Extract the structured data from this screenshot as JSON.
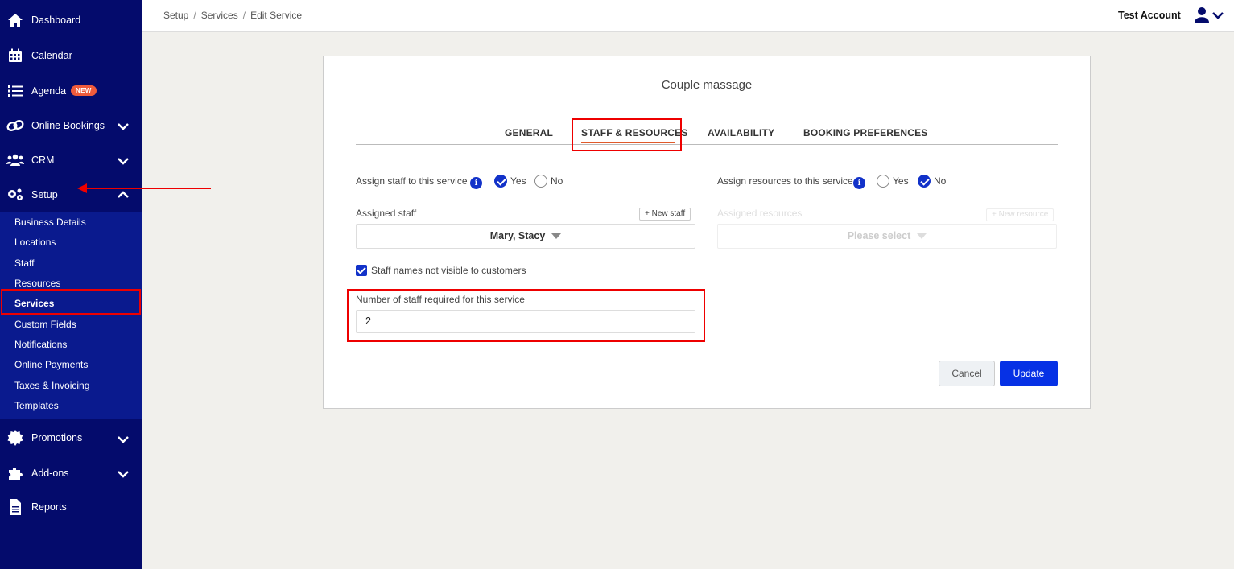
{
  "sidebar": {
    "items": [
      {
        "label": "Dashboard",
        "icon": "home-icon"
      },
      {
        "label": "Calendar",
        "icon": "calendar-icon"
      },
      {
        "label": "Agenda",
        "icon": "list-icon",
        "badge": "NEW"
      },
      {
        "label": "Online Bookings",
        "icon": "link-icon"
      },
      {
        "label": "CRM",
        "icon": "users-icon"
      },
      {
        "label": "Setup",
        "icon": "gears-icon"
      },
      {
        "label": "Promotions",
        "icon": "badge-icon"
      },
      {
        "label": "Add-ons",
        "icon": "puzzle-icon"
      },
      {
        "label": "Reports",
        "icon": "document-icon"
      }
    ],
    "setup_sub": [
      "Business Details",
      "Locations",
      "Staff",
      "Resources",
      "Services",
      "Custom Fields",
      "Notifications",
      "Online Payments",
      "Taxes & Invoicing",
      "Templates"
    ],
    "active_sub": "Services"
  },
  "header": {
    "breadcrumb": [
      "Setup",
      "Services",
      "Edit Service"
    ],
    "account": "Test Account"
  },
  "card": {
    "title": "Couple massage",
    "tabs": [
      "GENERAL",
      "STAFF & RESOURCES",
      "AVAILABILITY",
      "BOOKING PREFERENCES"
    ],
    "active_tab": "STAFF & RESOURCES",
    "assign_staff_label": "Assign staff to this service",
    "assign_resources_label": "Assign resources to this service",
    "yes": "Yes",
    "no": "No",
    "assign_staff_value": "Yes",
    "assign_resources_value": "No",
    "assigned_staff_label": "Assigned staff",
    "new_staff_button": "+ New staff",
    "assigned_staff_value": "Mary, Stacy",
    "assigned_resources_label": "Assigned resources",
    "new_resource_button": "+ New resource",
    "assigned_resources_placeholder": "Please select",
    "staff_names_hidden_label": "Staff names not visible to customers",
    "staff_names_hidden_checked": true,
    "num_staff_label": "Number of staff required for this service",
    "num_staff_value": "2",
    "cancel": "Cancel",
    "update": "Update"
  },
  "colors": {
    "sidebar_bg": "#040b6c",
    "submenu_bg": "#0a1a8e",
    "primary": "#0631e5",
    "badge": "#ef5b3c",
    "highlight": "#ee0000"
  }
}
